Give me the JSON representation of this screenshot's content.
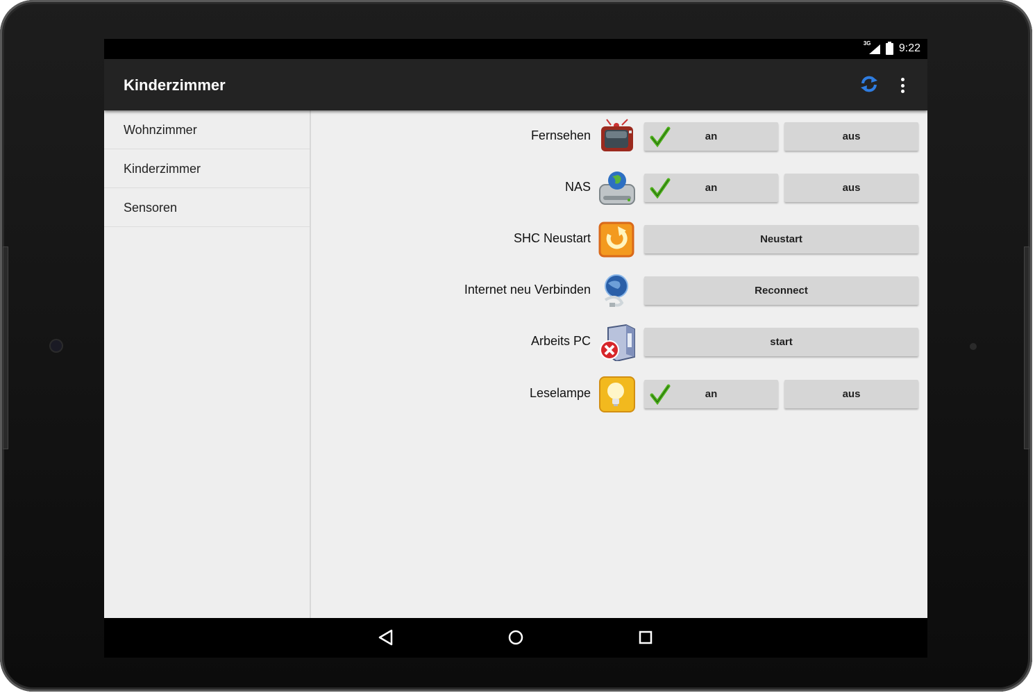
{
  "status_bar": {
    "network": "3G",
    "time": "9:22"
  },
  "app_bar": {
    "title": "Kinderzimmer",
    "actions": [
      "refresh-icon",
      "overflow-menu-icon"
    ]
  },
  "sidebar": {
    "items": [
      {
        "label": "Wohnzimmer"
      },
      {
        "label": "Kinderzimmer"
      },
      {
        "label": "Sensoren"
      }
    ]
  },
  "devices": [
    {
      "label": "Fernsehen",
      "icon": "tv-icon",
      "on_label": "an",
      "off_label": "aus",
      "state": "on"
    },
    {
      "label": "NAS",
      "icon": "nas-drive-icon",
      "on_label": "an",
      "off_label": "aus",
      "state": "on"
    },
    {
      "label": "SHC Neustart",
      "icon": "restart-icon",
      "action_label": "Neustart"
    },
    {
      "label": "Internet neu Verbinden",
      "icon": "network-icon",
      "action_label": "Reconnect"
    },
    {
      "label": "Arbeits PC",
      "icon": "computer-offline-icon",
      "action_label": "start"
    },
    {
      "label": "Leselampe",
      "icon": "lamp-icon",
      "on_label": "an",
      "off_label": "aus",
      "state": "on"
    }
  ],
  "colors": {
    "accent": "#2f7de1",
    "app_bar": "#232323",
    "button": "#d6d6d6",
    "check": "#4caf1a"
  },
  "nav_bar": [
    "back-icon",
    "home-icon",
    "recents-icon"
  ]
}
